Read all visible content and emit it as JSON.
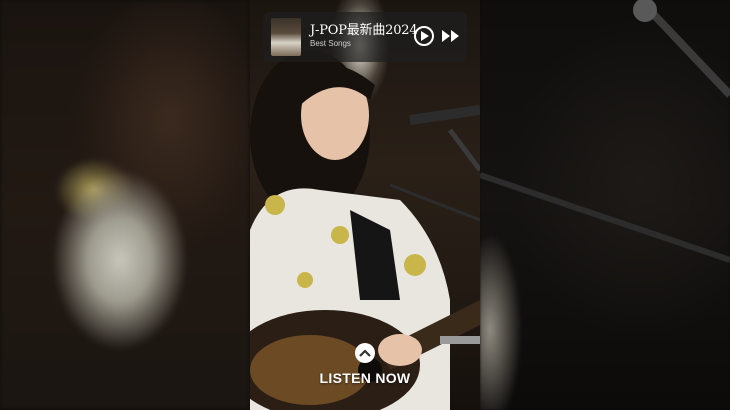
{
  "player": {
    "title": "J-POP最新曲2024",
    "subtitle": "Best Songs",
    "play_icon": "play-icon",
    "next_icon": "fast-forward-icon"
  },
  "cta": {
    "label": "LISTEN NOW",
    "icon": "chevron-up-icon"
  },
  "colors": {
    "overlay": "#1e1e1e",
    "text": "#ffffff"
  }
}
